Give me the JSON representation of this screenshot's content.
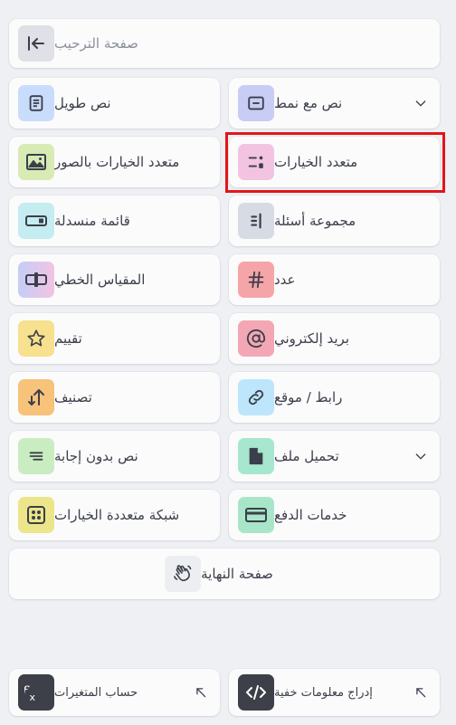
{
  "colors": {
    "background": "#eef0f3",
    "card": "#fbfbfc",
    "highlight": "#e3151a"
  },
  "welcome": {
    "label": "صفحة الترحيب",
    "icon": "collapse-left-icon",
    "color": "#dfe1e6"
  },
  "items": [
    {
      "label": "نص مع نمط",
      "icon": "text-frame-icon",
      "color": "#c7cdf5",
      "has_dropdown": true
    },
    {
      "label": "نص طويل",
      "icon": "document-lines-icon",
      "color": "#c9dcfb"
    },
    {
      "label": "متعدد الخيارات",
      "icon": "multiple-choice-icon",
      "color": "#f2c4e2"
    },
    {
      "label": "متعدد الخيارات بالصور",
      "icon": "image-icon",
      "color": "#d8ebb5"
    },
    {
      "label": "مجموعة أسئلة",
      "icon": "question-group-icon",
      "color": "#d7dbe4"
    },
    {
      "label": "قائمة منسدلة",
      "icon": "dropdown-toggle-icon",
      "color": "#c5ecf0"
    },
    {
      "label": "عدد",
      "icon": "hash-icon",
      "color": "#f5a5a8"
    },
    {
      "label": "المقياس الخطي",
      "icon": "linear-scale-icon",
      "color": "#c9d6f6"
    },
    {
      "label": "بريد إلكتروني",
      "icon": "at-sign-icon",
      "color": "#f3a7b4"
    },
    {
      "label": "تقييم",
      "icon": "star-icon",
      "color": "#f7e08e"
    },
    {
      "label": "رابط / موقع",
      "icon": "link-icon",
      "color": "#bde5fb"
    },
    {
      "label": "تصنيف",
      "icon": "sort-arrows-icon",
      "color": "#f7c27a"
    },
    {
      "label": "تحميل ملف",
      "icon": "file-icon",
      "color": "#a7e6cf",
      "has_dropdown": true
    },
    {
      "label": "نص بدون إجابة",
      "icon": "statement-lines-icon",
      "color": "#c9ecc0"
    },
    {
      "label": "خدمات الدفع",
      "icon": "credit-card-icon",
      "color": "#a9e6c9"
    },
    {
      "label": "شبكة متعددة الخيارات",
      "icon": "grid-icon",
      "color": "#ece58a"
    }
  ],
  "end": {
    "label": "صفحة النهاية",
    "icon": "waving-hand-icon",
    "color": "#eceef1"
  },
  "bottom": [
    {
      "label": "إدراج معلومات خفية",
      "icon": "code-icon",
      "color": "#3d4048"
    },
    {
      "label": "حساب المتغيرات",
      "icon": "function-fx-icon",
      "color": "#3d4048"
    }
  ]
}
